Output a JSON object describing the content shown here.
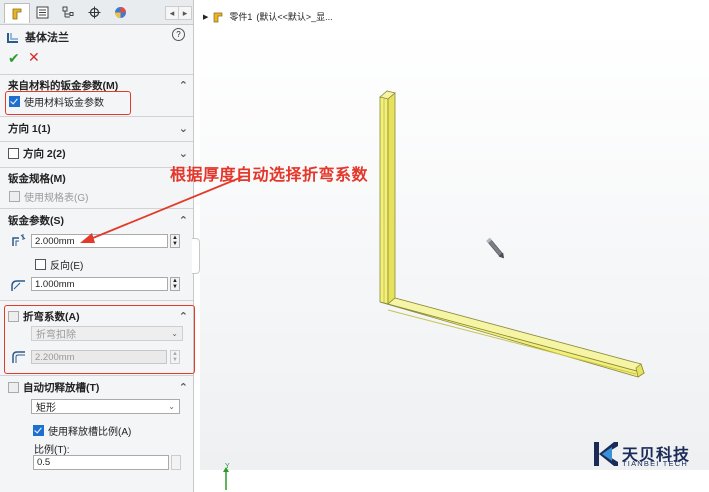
{
  "breadcrumb": {
    "arrow": "▶",
    "part_name": "零件1",
    "config": "(默认<<默认>_显..."
  },
  "panel": {
    "title": "基体法兰",
    "help": "?",
    "ok": "✔",
    "cancel": "✕",
    "sections": {
      "material": {
        "label": "来自材料的钣金参数(M)",
        "checkbox_label": "使用材料钣金参数",
        "checked": true
      },
      "direction1": {
        "label": "方向 1(1)"
      },
      "direction2": {
        "label": "方向 2(2)",
        "checked": false
      },
      "gauge": {
        "label": "钣金规格(M)",
        "checkbox_label": "使用规格表(G)"
      },
      "params": {
        "label": "钣金参数(S)",
        "thickness": "2.000mm",
        "reverse_label": "反向(E)",
        "bend_radius": "1.000mm"
      },
      "bend_allowance": {
        "label": "折弯系数(A)",
        "type": "折弯扣除",
        "value": "2.200mm"
      },
      "relief": {
        "label": "自动切释放槽(T)",
        "type": "矩形",
        "ratio_checkbox_label": "使用释放槽比例(A)",
        "ratio_checked": true,
        "ratio_label": "比例(T):",
        "ratio_value": "0.5"
      }
    }
  },
  "annotation": "根据厚度自动选择折弯系数",
  "logo": {
    "main": "天贝科技",
    "sub": "TIANBEI TECH"
  },
  "axis": "Y",
  "colors": {
    "accent_red": "#e23b2b",
    "part_yellow": "#f2f07a",
    "logo_blue": "#1a2b57"
  }
}
